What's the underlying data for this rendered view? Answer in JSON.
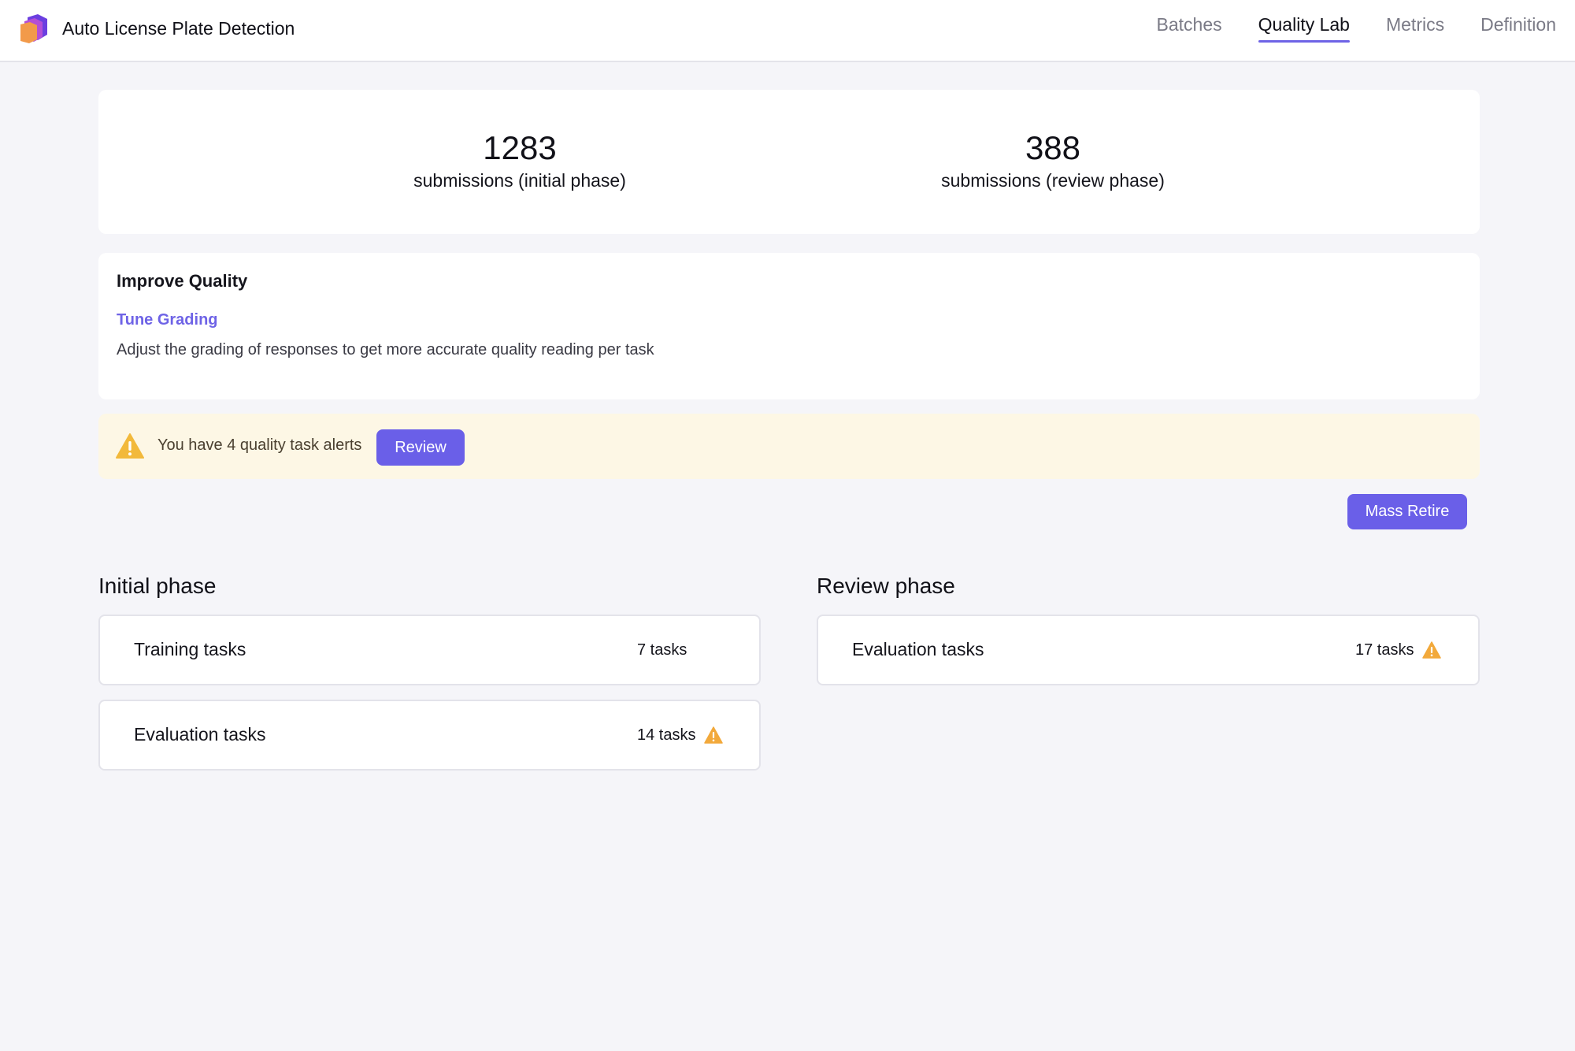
{
  "header": {
    "app_title": "Auto License Plate Detection",
    "nav": [
      {
        "label": "Batches",
        "active": false
      },
      {
        "label": "Quality Lab",
        "active": true
      },
      {
        "label": "Metrics",
        "active": false
      },
      {
        "label": "Definition",
        "active": false
      }
    ]
  },
  "stats": {
    "initial": {
      "value": "1283",
      "label": "submissions (initial phase)"
    },
    "review": {
      "value": "388",
      "label": "submissions (review phase)"
    }
  },
  "improve": {
    "title": "Improve Quality",
    "link": "Tune Grading",
    "description": "Adjust the grading of responses to get more accurate quality reading per task"
  },
  "alert": {
    "text": "You have 4 quality task alerts",
    "button": "Review",
    "icon": "warning-icon"
  },
  "mass_retire": "Mass Retire",
  "initial_phase": {
    "title": "Initial phase",
    "tasks": [
      {
        "name": "Training tasks",
        "count": "7 tasks",
        "warning": false
      },
      {
        "name": "Evaluation tasks",
        "count": "14 tasks",
        "warning": true
      }
    ]
  },
  "review_phase": {
    "title": "Review phase",
    "tasks": [
      {
        "name": "Evaluation tasks",
        "count": "17 tasks",
        "warning": true
      }
    ]
  },
  "colors": {
    "accent": "#6a5fe8",
    "warning": "#f2a93b",
    "alert_bg": "#fdf7e5",
    "page_bg": "#f5f5f9"
  }
}
